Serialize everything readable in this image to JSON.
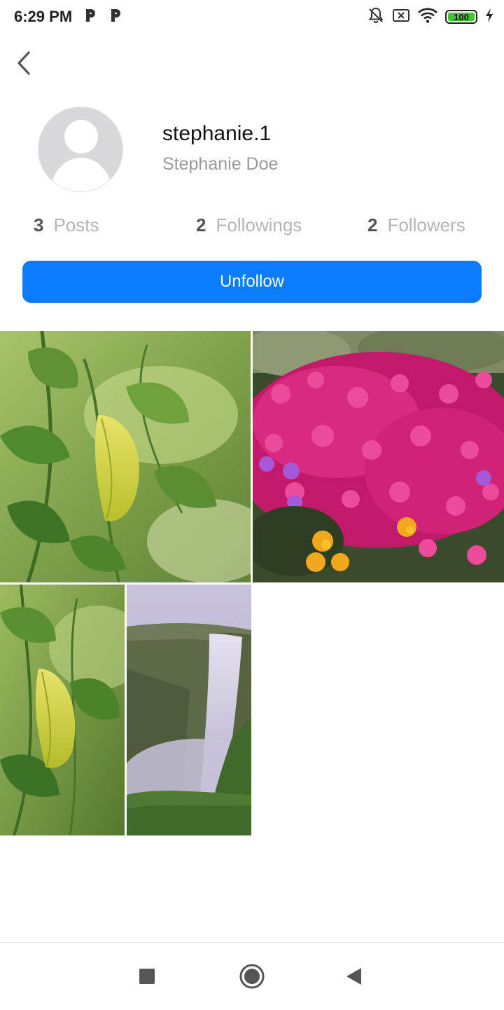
{
  "status_bar": {
    "time": "6:29 PM",
    "left_icons": [
      "parking-icon",
      "parking-icon"
    ],
    "right_icons": [
      "bell-off-icon",
      "sim-disabled-icon",
      "wifi-icon",
      "battery-icon",
      "charging-bolt-icon"
    ],
    "battery_level": "100",
    "battery_color": "#43c436"
  },
  "header": {
    "back_icon": "chevron-left-icon"
  },
  "profile": {
    "username": "stephanie.1",
    "full_name": "Stephanie Doe",
    "avatar_icon": "default-avatar-icon"
  },
  "stats": {
    "posts": {
      "count": "3",
      "label": "Posts"
    },
    "followings": {
      "count": "2",
      "label": "Followings"
    },
    "followers": {
      "count": "2",
      "label": "Followers"
    }
  },
  "actions": {
    "unfollow_label": "Unfollow",
    "accent_color": "#0a7cff"
  },
  "posts": [
    {
      "subject": "green leaves with a yellow leaf"
    },
    {
      "subject": "field of magenta and yellow flowers"
    },
    {
      "subject": "green leaves with a yellow leaf"
    },
    {
      "subject": "waterfall over a cliff"
    }
  ],
  "nav_bar": {
    "icons": [
      "recents-square-icon",
      "home-circle-icon",
      "back-triangle-icon"
    ]
  }
}
